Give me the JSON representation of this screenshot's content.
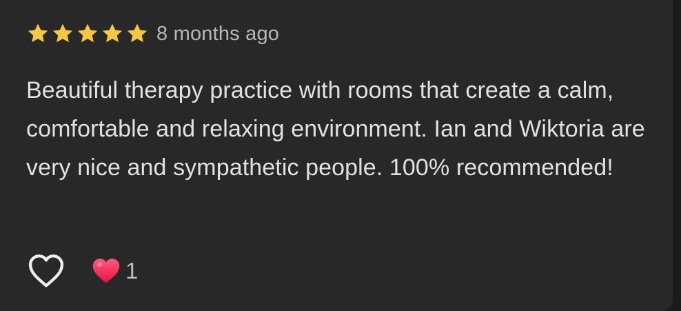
{
  "review": {
    "rating": 5,
    "rating_max": 5,
    "time_ago": "8 months ago",
    "text": "Beautiful therapy practice with rooms that create a calm, comfortable and relaxing environment. Ian and Wiktoria are very nice and sympathetic people. 100% recommended!",
    "reaction_count": "1"
  },
  "icons": {
    "star": "star-icon",
    "like": "heart-outline-icon",
    "reaction": "heart-filled-icon"
  },
  "colors": {
    "background": "#282828",
    "star": "#f6c744",
    "heart": "#f2285a",
    "text": "#e1e1e1",
    "muted_text": "#b9b9b9"
  }
}
